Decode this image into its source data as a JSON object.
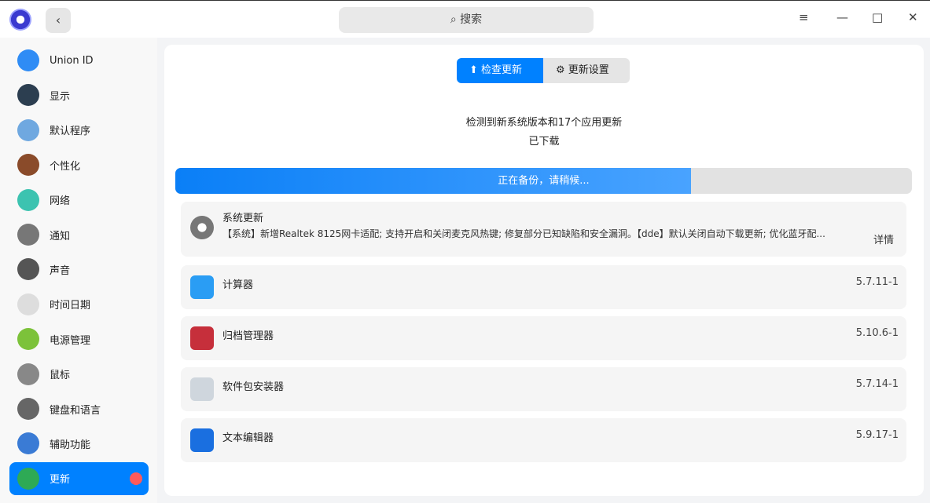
{
  "titlebar": {
    "search_placeholder": "搜索",
    "back": "‹",
    "menu": "≡",
    "minimize": "—",
    "maximize": "□",
    "close": "✕"
  },
  "sidebar": {
    "items": [
      {
        "label": "Union ID",
        "color": "#2f8cf5"
      },
      {
        "label": "显示",
        "color": "#2c3e50"
      },
      {
        "label": "默认程序",
        "color": "#6fa8e0"
      },
      {
        "label": "个性化",
        "color": "#8a4b2a"
      },
      {
        "label": "网络",
        "color": "#3cc3b0"
      },
      {
        "label": "通知",
        "color": "#777"
      },
      {
        "label": "声音",
        "color": "#555"
      },
      {
        "label": "时间日期",
        "color": "#ddd"
      },
      {
        "label": "电源管理",
        "color": "#7cc23a"
      },
      {
        "label": "鼠标",
        "color": "#888"
      },
      {
        "label": "键盘和语言",
        "color": "#666"
      },
      {
        "label": "辅助功能",
        "color": "#3a7bd5"
      },
      {
        "label": "更新",
        "color": "#2eaa55"
      }
    ]
  },
  "tabs": {
    "check": "检查更新",
    "settings": "更新设置"
  },
  "status": {
    "line1": "检测到新系统版本和17个应用更新",
    "line2": "已下载"
  },
  "progress": {
    "label": "正在备份，请稍候...",
    "percent": 70
  },
  "system_update": {
    "title": "系统更新",
    "desc": "【系统】新增Realtek 8125网卡适配; 支持开启和关闭麦克风热键; 修复部分已知缺陷和安全漏洞。【dde】默认关闭自动下载更新; 优化蓝牙配...",
    "details": "详情"
  },
  "apps": [
    {
      "name": "计算器",
      "version": "5.7.11-1",
      "color": "#2a9df4"
    },
    {
      "name": "归档管理器",
      "version": "5.10.6-1",
      "color": "#c62f3b"
    },
    {
      "name": "软件包安装器",
      "version": "5.7.14-1",
      "color": "#cfd6dd"
    },
    {
      "name": "文本编辑器",
      "version": "5.9.17-1",
      "color": "#1a6fe0"
    }
  ]
}
